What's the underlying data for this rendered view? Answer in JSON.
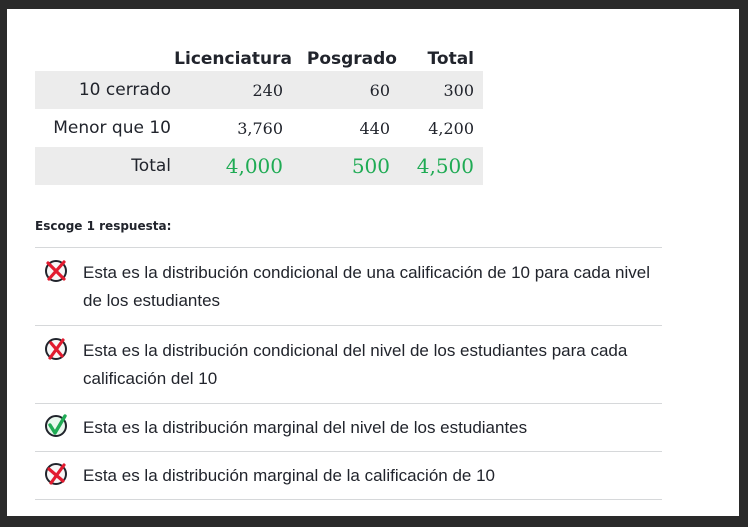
{
  "table": {
    "headers": [
      "Licenciatura",
      "Posgrado",
      "Total"
    ],
    "rows": [
      {
        "label": "10 cerrado",
        "values": [
          "240",
          "60",
          "300"
        ]
      },
      {
        "label": "Menor que 10",
        "values": [
          "3,760",
          "440",
          "4,200"
        ]
      },
      {
        "label": "Total",
        "values": [
          "4,000",
          "500",
          "4,500"
        ]
      }
    ],
    "total_color": "#1fab54"
  },
  "prompt": "Escoge 1 respuesta:",
  "choices": [
    {
      "text": "Esta es la distribución condicional de una calificación de 10 para cada nivel de los estudiantes",
      "status": "incorrect",
      "icon": "x-mark-icon"
    },
    {
      "text": "Esta es la distribución condicional del nivel de los estudiantes para cada calificación del 10",
      "status": "incorrect",
      "icon": "x-mark-icon"
    },
    {
      "text": "Esta es la distribución marginal del nivel de los estudiantes",
      "status": "correct",
      "icon": "check-mark-icon"
    },
    {
      "text": "Esta es la distribución marginal de la calificación de 10",
      "status": "incorrect",
      "icon": "x-mark-icon"
    }
  ]
}
